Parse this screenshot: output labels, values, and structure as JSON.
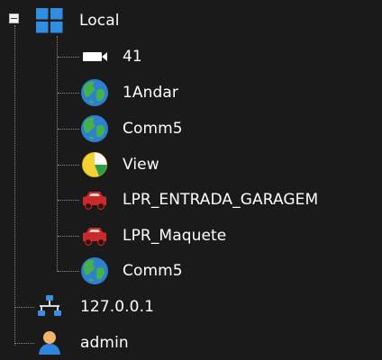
{
  "tree": {
    "root": {
      "label": "Local",
      "icon": "windows-logo-icon",
      "expanded": true
    },
    "children": [
      {
        "label": "41",
        "icon": "camera-icon"
      },
      {
        "label": "1Andar",
        "icon": "globe-icon"
      },
      {
        "label": "Comm5",
        "icon": "globe-icon"
      },
      {
        "label": "View",
        "icon": "pie-chart-icon"
      },
      {
        "label": "LPR_ENTRADA_GARAGEM",
        "icon": "red-car-icon"
      },
      {
        "label": "LPR_Maquete",
        "icon": "red-car-icon"
      },
      {
        "label": "Comm5",
        "icon": "globe-icon"
      }
    ],
    "siblings": [
      {
        "label": "127.0.0.1",
        "icon": "network-icon"
      },
      {
        "label": "admin",
        "icon": "user-icon"
      }
    ]
  },
  "colors": {
    "background": "#1a1a1a",
    "text": "#ffffff",
    "connector": "#8a8a8a",
    "windows_blue": "#2f8ee0",
    "globe_blue": "#2f7fd0",
    "globe_green": "#43b24a",
    "car_red": "#c92b2b",
    "pie_yellow": "#f3d331"
  }
}
